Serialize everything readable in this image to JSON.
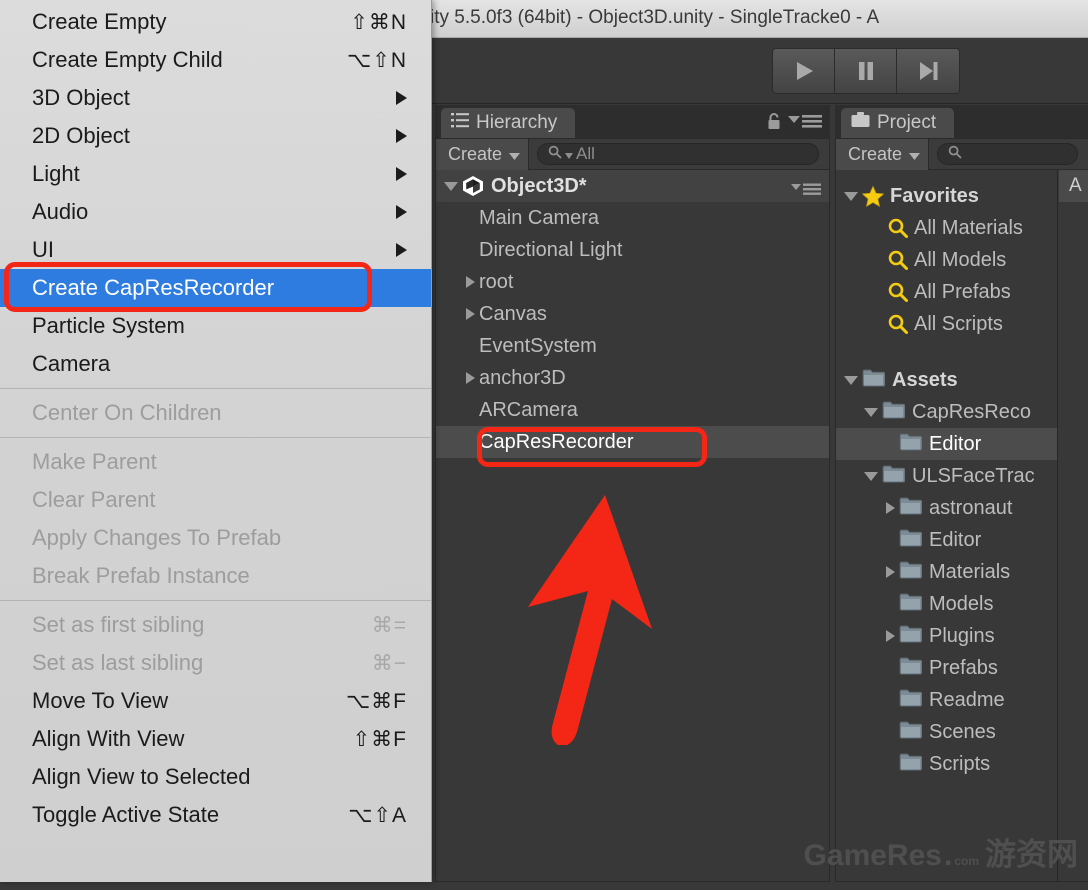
{
  "window": {
    "title": "ity 5.5.0f3 (64bit) - Object3D.unity - SingleTracke0 - A"
  },
  "toolbar": {
    "play_label": "Play",
    "pause_label": "Pause",
    "step_label": "Step"
  },
  "context_menu": {
    "groups": [
      {
        "items": [
          {
            "label": "Create Empty",
            "accel": "⇧⌘N",
            "state": "normal",
            "submenu": false
          },
          {
            "label": "Create Empty Child",
            "accel": "⌥⇧N",
            "state": "normal",
            "submenu": false
          },
          {
            "label": "3D Object",
            "accel": "",
            "state": "normal",
            "submenu": true
          },
          {
            "label": "2D Object",
            "accel": "",
            "state": "normal",
            "submenu": true
          },
          {
            "label": "Light",
            "accel": "",
            "state": "normal",
            "submenu": true
          },
          {
            "label": "Audio",
            "accel": "",
            "state": "normal",
            "submenu": true
          },
          {
            "label": "UI",
            "accel": "",
            "state": "normal",
            "submenu": true
          },
          {
            "label": "Create CapResRecorder",
            "accel": "",
            "state": "active",
            "submenu": false
          },
          {
            "label": "Particle System",
            "accel": "",
            "state": "normal",
            "submenu": false
          },
          {
            "label": "Camera",
            "accel": "",
            "state": "normal",
            "submenu": false
          }
        ]
      },
      {
        "items": [
          {
            "label": "Center On Children",
            "accel": "",
            "state": "disabled",
            "submenu": false
          }
        ]
      },
      {
        "items": [
          {
            "label": "Make Parent",
            "accel": "",
            "state": "disabled",
            "submenu": false
          },
          {
            "label": "Clear Parent",
            "accel": "",
            "state": "disabled",
            "submenu": false
          },
          {
            "label": "Apply Changes To Prefab",
            "accel": "",
            "state": "disabled",
            "submenu": false
          },
          {
            "label": "Break Prefab Instance",
            "accel": "",
            "state": "disabled",
            "submenu": false
          }
        ]
      },
      {
        "items": [
          {
            "label": "Set as first sibling",
            "accel": "⌘=",
            "state": "disabled",
            "submenu": false
          },
          {
            "label": "Set as last sibling",
            "accel": "⌘−",
            "state": "disabled",
            "submenu": false
          },
          {
            "label": "Move To View",
            "accel": "⌥⌘F",
            "state": "normal",
            "submenu": false
          },
          {
            "label": "Align With View",
            "accel": "⇧⌘F",
            "state": "normal",
            "submenu": false
          },
          {
            "label": "Align View to Selected",
            "accel": "",
            "state": "normal",
            "submenu": false
          },
          {
            "label": "Toggle Active State",
            "accel": "⌥⇧A",
            "state": "normal",
            "submenu": false
          }
        ]
      }
    ]
  },
  "hierarchy": {
    "tab_label": "Hierarchy",
    "create_label": "Create",
    "search_value": "All",
    "scene_name": "Object3D*",
    "items": [
      {
        "label": "Main Camera",
        "expandable": false,
        "indent": 1,
        "selected": false
      },
      {
        "label": "Directional Light",
        "expandable": false,
        "indent": 1,
        "selected": false
      },
      {
        "label": "root",
        "expandable": true,
        "indent": 1,
        "selected": false
      },
      {
        "label": "Canvas",
        "expandable": true,
        "indent": 1,
        "selected": false
      },
      {
        "label": "EventSystem",
        "expandable": false,
        "indent": 1,
        "selected": false
      },
      {
        "label": "anchor3D",
        "expandable": true,
        "indent": 1,
        "selected": false
      },
      {
        "label": "ARCamera",
        "expandable": false,
        "indent": 1,
        "selected": false
      },
      {
        "label": "CapResRecorder",
        "expandable": false,
        "indent": 1,
        "selected": true
      }
    ]
  },
  "project": {
    "tab_label": "Project",
    "create_label": "Create",
    "search_value": "",
    "favorites_label": "Favorites",
    "favorites": [
      {
        "label": "All Materials"
      },
      {
        "label": "All Models"
      },
      {
        "label": "All Prefabs"
      },
      {
        "label": "All Scripts"
      }
    ],
    "assets_label": "Assets",
    "tree": [
      {
        "label": "CapResReco",
        "indent": 2,
        "state": "open",
        "selected": false
      },
      {
        "label": "Editor",
        "indent": 3,
        "state": "leaf",
        "selected": true
      },
      {
        "label": "ULSFaceTrac",
        "indent": 2,
        "state": "open",
        "selected": false
      },
      {
        "label": "astronaut",
        "indent": 3,
        "state": "closed",
        "selected": false
      },
      {
        "label": "Editor",
        "indent": 3,
        "state": "leaf",
        "selected": false
      },
      {
        "label": "Materials",
        "indent": 3,
        "state": "closed",
        "selected": false
      },
      {
        "label": "Models",
        "indent": 3,
        "state": "leaf",
        "selected": false
      },
      {
        "label": "Plugins",
        "indent": 3,
        "state": "closed",
        "selected": false
      },
      {
        "label": "Prefabs",
        "indent": 3,
        "state": "leaf",
        "selected": false
      },
      {
        "label": "Readme",
        "indent": 3,
        "state": "leaf",
        "selected": false
      },
      {
        "label": "Scenes",
        "indent": 3,
        "state": "leaf",
        "selected": false
      },
      {
        "label": "Scripts",
        "indent": 3,
        "state": "leaf",
        "selected": false
      }
    ],
    "right_column_header": "A"
  },
  "watermark": {
    "brand": "GameRes",
    "dot": ".",
    "tld": "com",
    "cn": "游资网"
  },
  "colors": {
    "menu_highlight": "#2f7ce0",
    "annotation_red": "#f42717",
    "panel_bg": "#383838",
    "favorite_yellow": "#f5cc12"
  }
}
